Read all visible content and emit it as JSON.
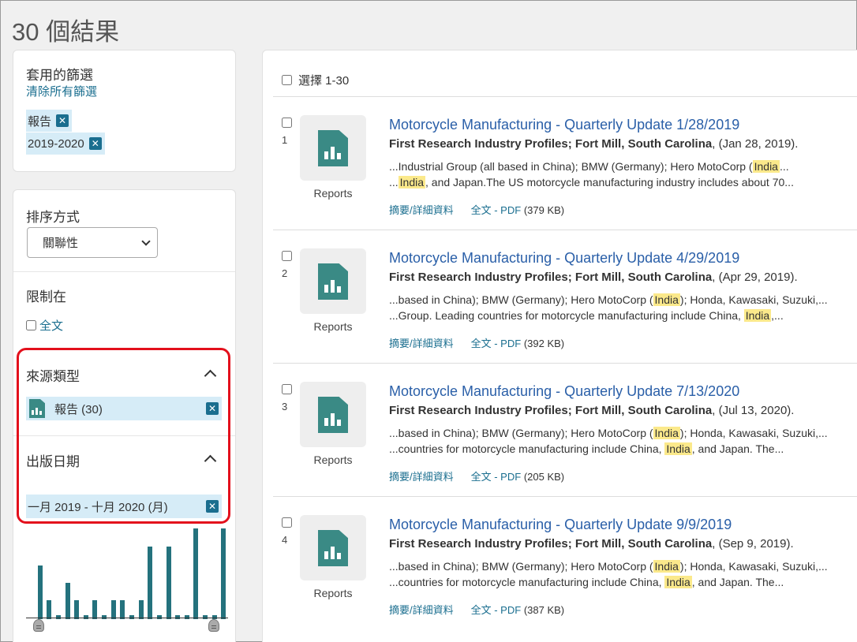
{
  "header": {
    "title": "30 個結果"
  },
  "applied_filters": {
    "heading": "套用的篩選",
    "clear_label": "清除所有篩選",
    "chips": [
      "報告",
      "2019-2020"
    ]
  },
  "sort": {
    "label": "排序方式",
    "selected": "關聯性"
  },
  "limit": {
    "label": "限制在",
    "fulltext_label": "全文"
  },
  "source_type": {
    "label": "來源類型",
    "facet": "報告 (30)"
  },
  "pub_date": {
    "label": "出版日期",
    "facet": "一月 2019 - 十月 2020 (月)"
  },
  "histogram": {
    "values": [
      0,
      68,
      24,
      5,
      46,
      24,
      5,
      24,
      5,
      24,
      24,
      5,
      24,
      92,
      5,
      92,
      5,
      5,
      115,
      5,
      5,
      115
    ]
  },
  "results_panel": {
    "select_all_label": "選擇 1-30"
  },
  "results": [
    {
      "num": "1",
      "type_label": "Reports",
      "title": "Motorcycle Manufacturing - Quarterly Update 1/28/2019",
      "source": "First Research Industry Profiles; Fort Mill, South Carolina",
      "date": ", (Jan 28, 2019).",
      "snip1_pre": "...Industrial Group (all based in China); BMW (Germany); Hero MotoCorp (",
      "snip1_hl": "India",
      "snip1_post": "...",
      "snip2_pre": "...",
      "snip2_hl": "India",
      "snip2_post": ", and Japan.The US motorcycle manufacturing industry includes about 70...",
      "link_abstract": "摘要/詳細資料",
      "link_pdf": "全文 - PDF",
      "size": "(379 KB)"
    },
    {
      "num": "2",
      "type_label": "Reports",
      "title": "Motorcycle Manufacturing - Quarterly Update 4/29/2019",
      "source": "First Research Industry Profiles; Fort Mill, South Carolina",
      "date": ", (Apr 29, 2019).",
      "snip1_pre": "...based in China); BMW (Germany); Hero MotoCorp (",
      "snip1_hl": "India",
      "snip1_post": "); Honda, Kawasaki, Suzuki,...",
      "snip2_pre": "...Group. Leading countries for motorcycle manufacturing include China, ",
      "snip2_hl": "India",
      "snip2_post": ",...",
      "link_abstract": "摘要/詳細資料",
      "link_pdf": "全文 - PDF",
      "size": "(392 KB)"
    },
    {
      "num": "3",
      "type_label": "Reports",
      "title": "Motorcycle Manufacturing - Quarterly Update 7/13/2020",
      "source": "First Research Industry Profiles; Fort Mill, South Carolina",
      "date": ", (Jul 13, 2020).",
      "snip1_pre": "...based in China); BMW (Germany); Hero MotoCorp (",
      "snip1_hl": "India",
      "snip1_post": "); Honda, Kawasaki, Suzuki,...",
      "snip2_pre": "...countries for motorcycle manufacturing include China, ",
      "snip2_hl": "India",
      "snip2_post": ", and Japan. The...",
      "link_abstract": "摘要/詳細資料",
      "link_pdf": "全文 - PDF",
      "size": "(205 KB)"
    },
    {
      "num": "4",
      "type_label": "Reports",
      "title": "Motorcycle Manufacturing - Quarterly Update 9/9/2019",
      "source": "First Research Industry Profiles; Fort Mill, South Carolina",
      "date": ", (Sep 9, 2019).",
      "snip1_pre": "...based in China); BMW (Germany); Hero MotoCorp (",
      "snip1_hl": "India",
      "snip1_post": "); Honda, Kawasaki, Suzuki,...",
      "snip2_pre": "...countries for motorcycle manufacturing include China, ",
      "snip2_hl": "India",
      "snip2_post": ", and Japan. The...",
      "link_abstract": "摘要/詳細資料",
      "link_pdf": "全文 - PDF",
      "size": "(387 KB)"
    }
  ]
}
